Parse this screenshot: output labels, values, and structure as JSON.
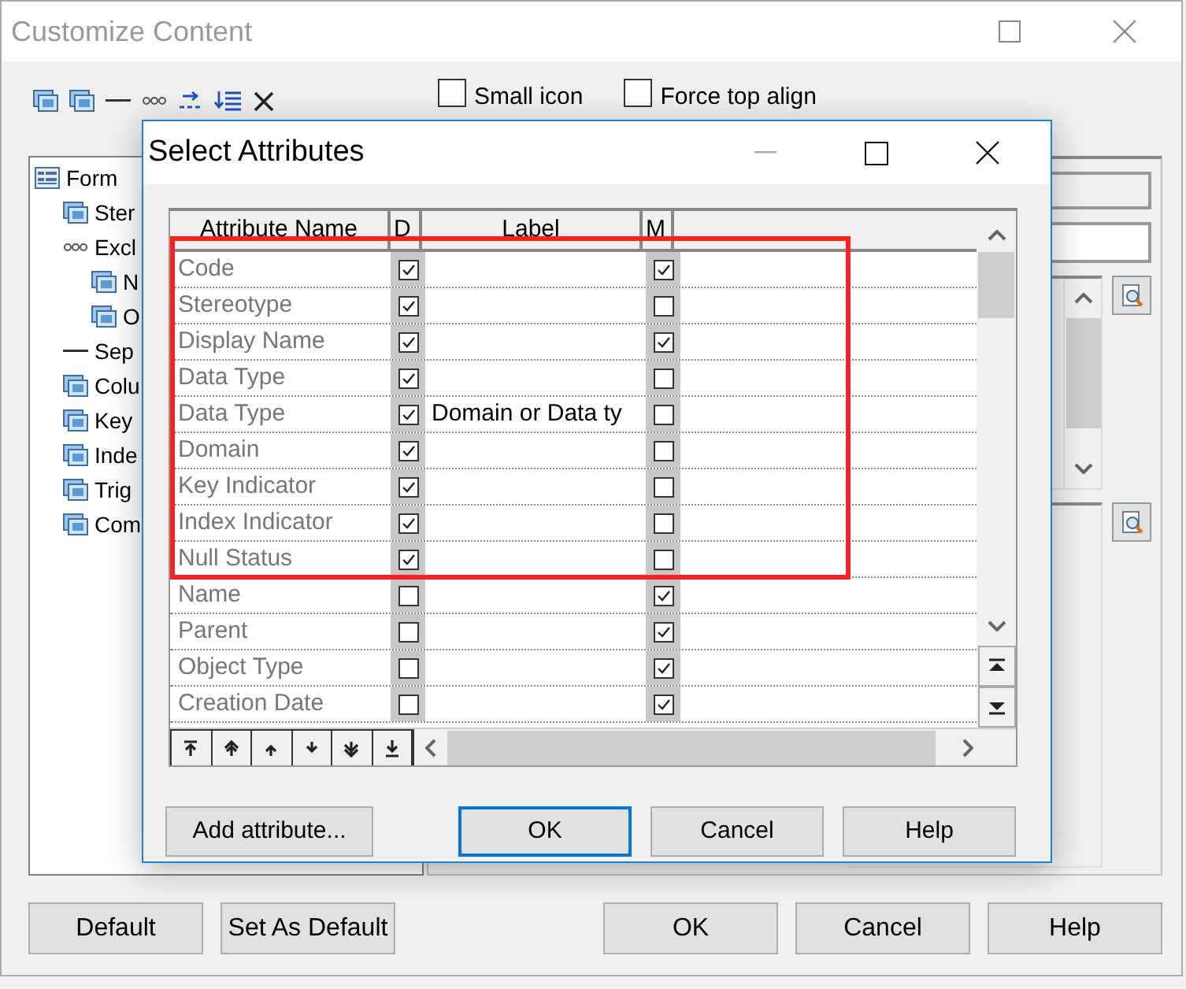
{
  "window": {
    "title": "Customize Content"
  },
  "options": [
    {
      "label": "Small icon",
      "checked": false
    },
    {
      "label": "Force top align",
      "checked": false
    }
  ],
  "tree": [
    {
      "label": "Form",
      "kind": "form",
      "children": [
        {
          "label": "Ster",
          "kind": "item"
        },
        {
          "label": "Excl",
          "kind": "exclusive",
          "children": [
            {
              "label": "N",
              "kind": "item"
            },
            {
              "label": "O",
              "kind": "item"
            }
          ]
        },
        {
          "label": "Sep",
          "kind": "separator"
        },
        {
          "label": "Colu",
          "kind": "item"
        },
        {
          "label": "Key",
          "kind": "item"
        },
        {
          "label": "Inde",
          "kind": "item"
        },
        {
          "label": "Trig",
          "kind": "item"
        },
        {
          "label": "Com",
          "kind": "item"
        }
      ]
    }
  ],
  "buttons": [
    "Default",
    "Set As Default",
    "OK",
    "Cancel",
    "Help"
  ],
  "dialog": {
    "title": "Select Attributes",
    "columns": [
      "Attribute Name",
      "D",
      "Label",
      "M"
    ],
    "rows": [
      {
        "name": "Code",
        "d": {
          "checked": true
        },
        "m": {
          "checked": true
        }
      },
      {
        "name": "Stereotype",
        "d": {
          "checked": true
        },
        "m": {
          "checked": false
        }
      },
      {
        "name": "Display Name",
        "d": {
          "checked": true
        },
        "m": {
          "checked": true
        }
      },
      {
        "name": "Data Type",
        "d": {
          "checked": true
        },
        "m": {
          "checked": false
        }
      },
      {
        "name": "Data Type",
        "d": {
          "checked": true
        },
        "label": "Domain or Data ty",
        "m": {
          "checked": false
        }
      },
      {
        "name": "Domain",
        "d": {
          "checked": true
        },
        "m": {
          "checked": false
        }
      },
      {
        "name": "Key Indicator",
        "d": {
          "checked": true
        },
        "m": {
          "checked": false
        }
      },
      {
        "name": "Index Indicator",
        "d": {
          "checked": true
        },
        "m": {
          "checked": false
        }
      },
      {
        "name": "Null Status",
        "d": {
          "checked": true
        },
        "m": {
          "checked": false
        }
      },
      {
        "name": "Name",
        "d": {
          "checked": false
        },
        "m": {
          "checked": true
        }
      },
      {
        "name": "Parent",
        "d": {
          "checked": false
        },
        "m": {
          "checked": true
        }
      },
      {
        "name": "Object Type",
        "d": {
          "checked": false
        },
        "m": {
          "checked": true
        }
      },
      {
        "name": "Creation Date",
        "d": {
          "checked": false
        },
        "m": {
          "checked": true
        }
      }
    ],
    "buttons": [
      {
        "label": "Add attribute...",
        "default": false
      },
      {
        "label": "OK",
        "default": true
      },
      {
        "label": "Cancel",
        "default": false
      },
      {
        "label": "Help",
        "default": false
      }
    ]
  }
}
